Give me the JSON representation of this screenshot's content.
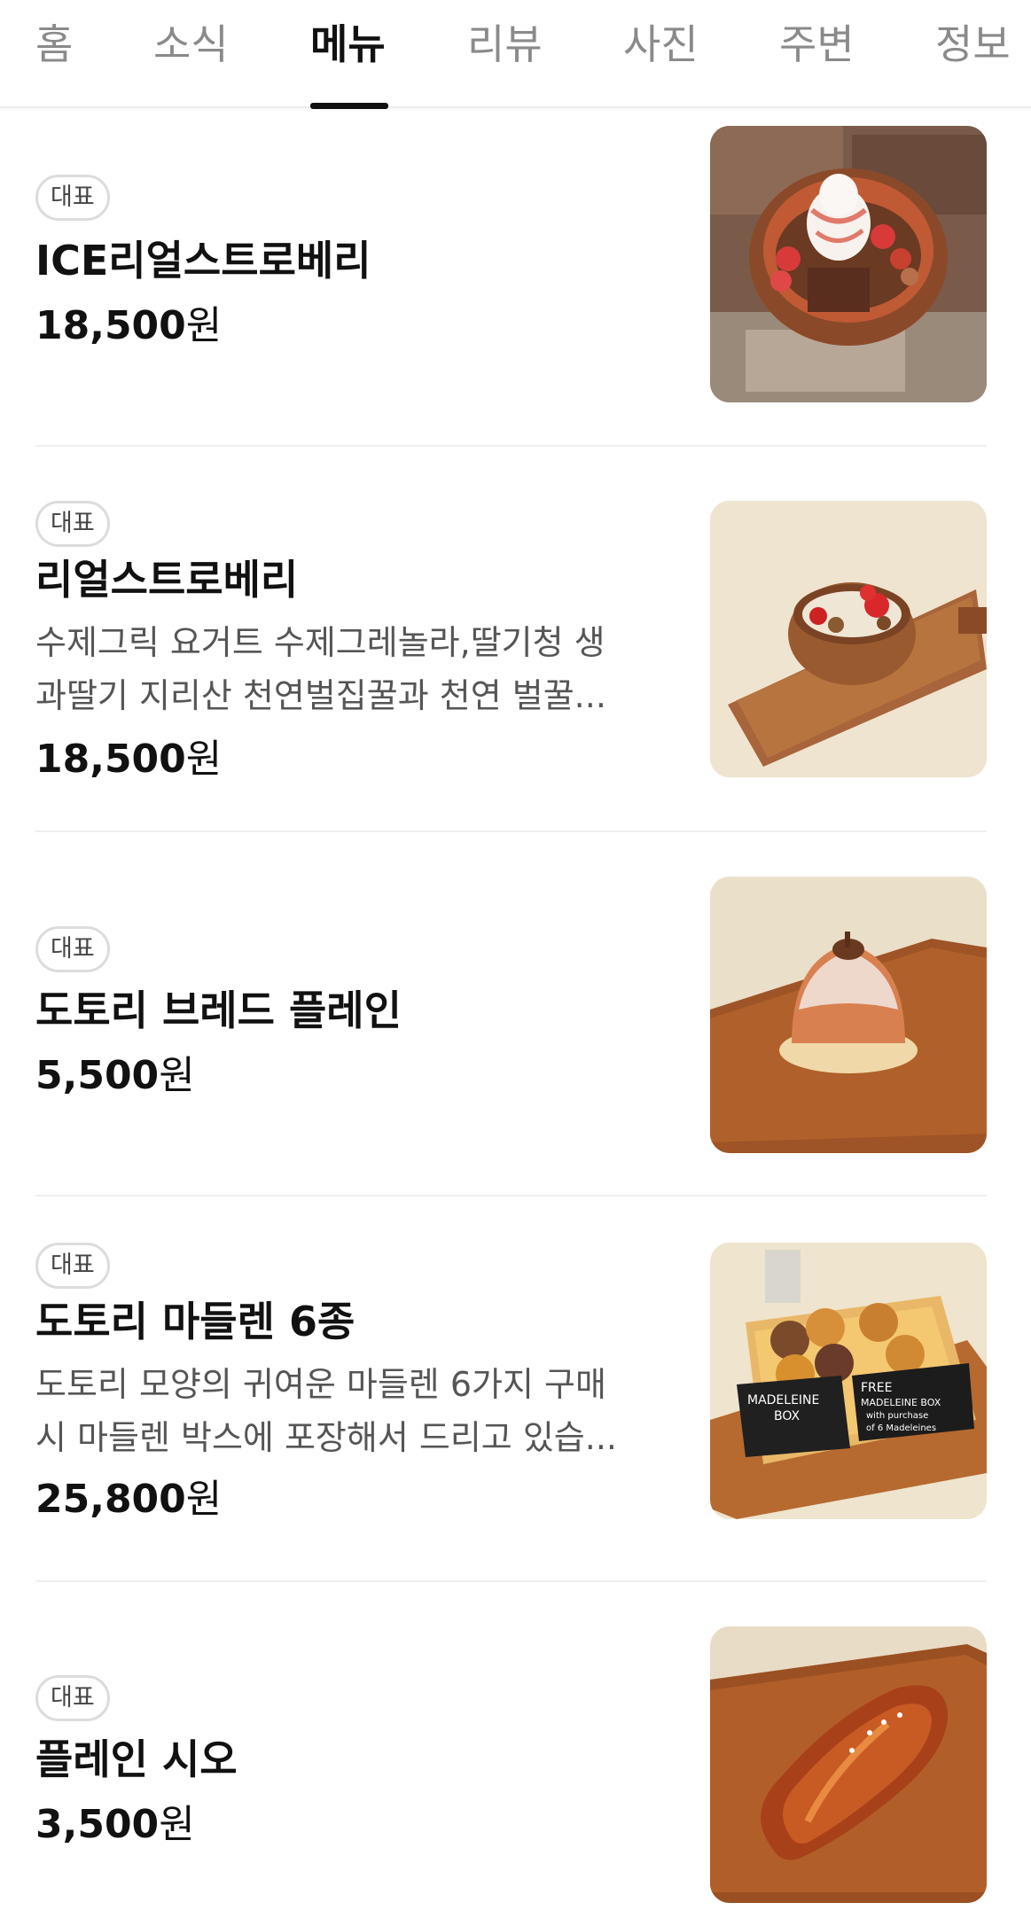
{
  "tabs": [
    {
      "label": "홈"
    },
    {
      "label": "소식"
    },
    {
      "label": "메뉴",
      "active": true
    },
    {
      "label": "리뷰"
    },
    {
      "label": "사진"
    },
    {
      "label": "주변"
    },
    {
      "label": "정보"
    }
  ],
  "menu": {
    "items": [
      {
        "badge": "대표",
        "name": "ICE리얼스트로베리",
        "description": [],
        "price": "18,500",
        "currency": "원",
        "image_icon": "strawberry-ice-cream-bowl-image"
      },
      {
        "badge": "대표",
        "name": "리얼스트로베리",
        "description": [
          "수제그릭 요거트 수제그레놀라,딸기청 생",
          "과딸기 지리산 천연벌집꿀과 천연 벌꿀..."
        ],
        "price": "18,500",
        "currency": "원",
        "image_icon": "strawberry-yogurt-bowl-image"
      },
      {
        "badge": "대표",
        "name": "도토리 브레드 플레인",
        "description": [],
        "price": "5,500",
        "currency": "원",
        "image_icon": "acorn-bread-image"
      },
      {
        "badge": "대표",
        "name": "도토리 마들렌 6종",
        "description": [
          "도토리 모양의 귀여운 마들렌 6가지 구매",
          "시 마들렌 박스에 포장해서 드리고 있습..."
        ],
        "price": "25,800",
        "currency": "원",
        "image_icon": "madeleine-box-image",
        "image_text": [
          "MADELEINE",
          "BOX",
          "FREE",
          "MADELEINE BOX",
          "with purchase",
          "of 6 Madeleines"
        ]
      },
      {
        "badge": "대표",
        "name": "플레인 시오",
        "description": [],
        "price": "3,500",
        "currency": "원",
        "image_icon": "salt-bread-image"
      }
    ]
  },
  "colors": {
    "active_tab": "#111111",
    "inactive_tab": "#8a8a8a",
    "badge_border": "#dcdcdc",
    "description": "#555555",
    "divider": "#eeeeee"
  }
}
